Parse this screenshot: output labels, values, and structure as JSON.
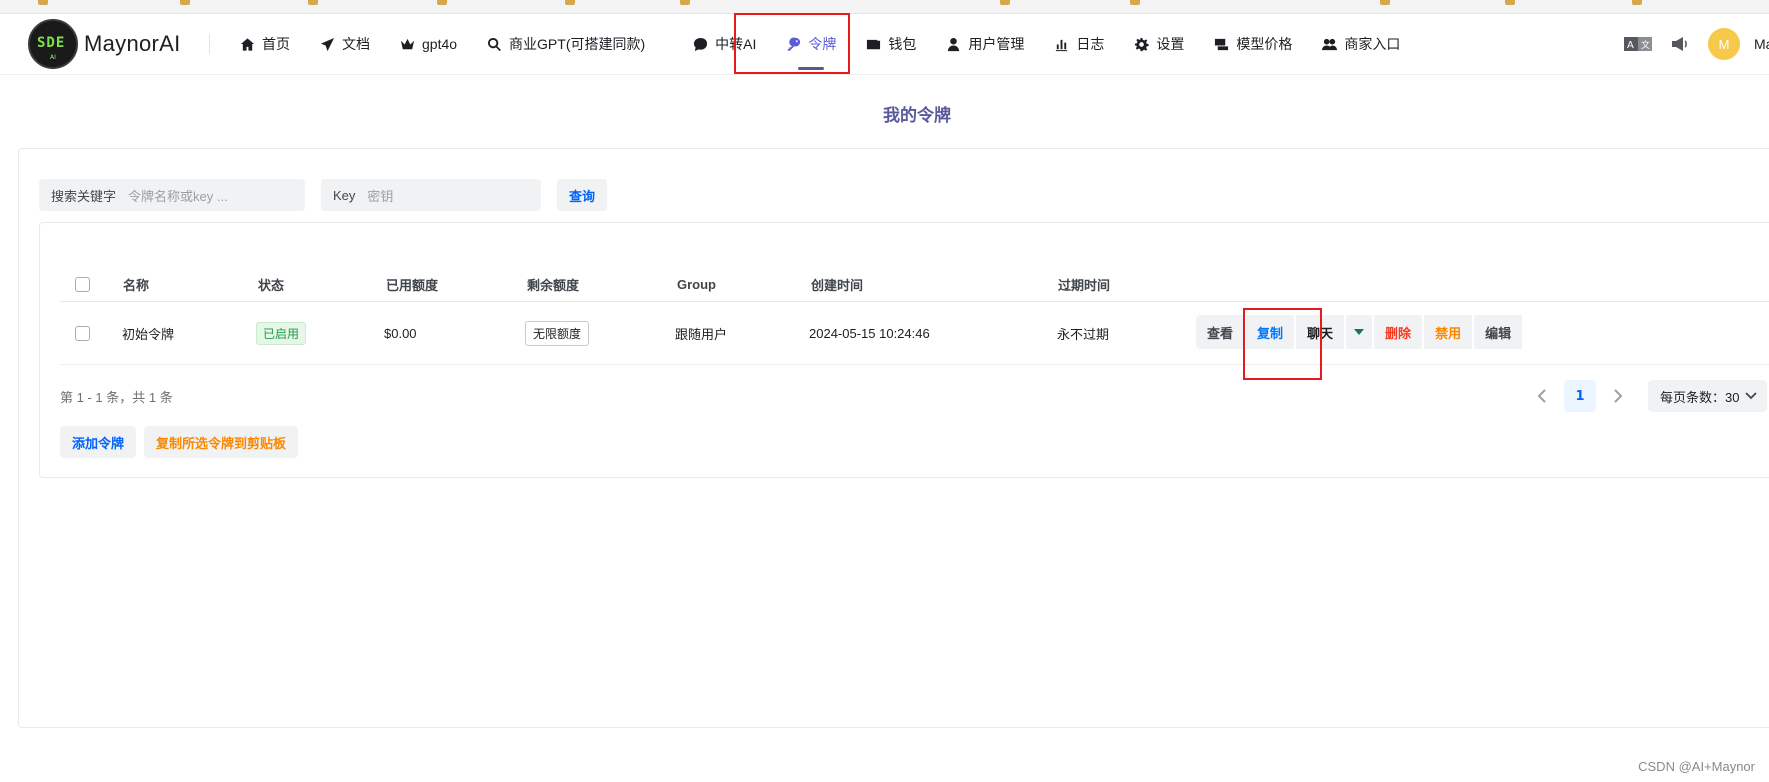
{
  "app": {
    "name": "MaynorAI"
  },
  "nav": {
    "items": [
      {
        "label": "首页",
        "icon": "home-icon"
      },
      {
        "label": "文档",
        "icon": "send-icon"
      },
      {
        "label": "gpt4o",
        "icon": "crown-icon"
      },
      {
        "label": "商业GPT(可搭建同款)",
        "icon": "search-icon"
      },
      {
        "label": "中转AI",
        "icon": "chat-icon"
      },
      {
        "label": "令牌",
        "icon": "key-icon",
        "active": true
      },
      {
        "label": "钱包",
        "icon": "wallet-icon"
      },
      {
        "label": "用户管理",
        "icon": "user-icon"
      },
      {
        "label": "日志",
        "icon": "chart-icon"
      },
      {
        "label": "设置",
        "icon": "gear-icon"
      },
      {
        "label": "模型价格",
        "icon": "price-icon"
      },
      {
        "label": "商家入口",
        "icon": "users-icon"
      }
    ]
  },
  "header_right": {
    "avatar_initial": "M",
    "username": "Mayn"
  },
  "page": {
    "title": "我的令牌"
  },
  "search": {
    "keyword_label": "搜索关键字",
    "keyword_placeholder": "令牌名称或key ...",
    "key_label": "Key",
    "key_placeholder": "密钥",
    "query_button": "查询"
  },
  "table": {
    "columns": [
      "名称",
      "状态",
      "已用额度",
      "剩余额度",
      "Group",
      "创建时间",
      "过期时间"
    ],
    "rows": [
      {
        "name": "初始令牌",
        "status": "已启用",
        "used": "$0.00",
        "remaining": "无限额度",
        "group": "跟随用户",
        "created": "2024-05-15 10:24:46",
        "expires": "永不过期"
      }
    ],
    "actions": {
      "view": "查看",
      "copy": "复制",
      "chat": "聊天",
      "delete": "删除",
      "disable": "禁用",
      "edit": "编辑"
    }
  },
  "pagination": {
    "summary": "第 1 - 1 条，共 1 条",
    "current_page": "1",
    "page_size_label": "每页条数：30"
  },
  "bottom_buttons": {
    "add": "添加令牌",
    "copy_selected": "复制所选令牌到剪贴板"
  },
  "watermark": "CSDN @AI+Maynor",
  "colors": {
    "accent": "#5b5bd6",
    "primary": "#0064fa",
    "danger": "#f93920",
    "warning": "#fc8800",
    "success": "#1e9e47",
    "highlight_box": "#e8191c"
  }
}
